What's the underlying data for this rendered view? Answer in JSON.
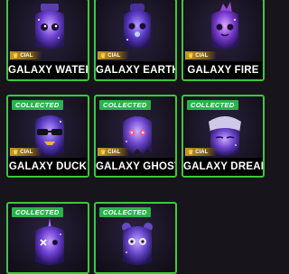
{
  "colors": {
    "card_border": "#3cc83c",
    "badge_bg": "#29b34a",
    "special_bg": "#c89a2c",
    "label_bg": "#000000"
  },
  "cards": [
    {
      "name": "GALAXY WATEF",
      "collected": "",
      "special": "CIAL",
      "icon": "galaxy-water-mascot"
    },
    {
      "name": "GALAXY EARTH",
      "collected": "",
      "special": "CIAL",
      "icon": "galaxy-earth-mascot"
    },
    {
      "name": "GALAXY FIRE",
      "collected": "",
      "special": "CIAL",
      "icon": "galaxy-fire-mascot"
    },
    {
      "name": "GALAXY DUCK",
      "collected": "COLLECTED",
      "special": "CIAL",
      "icon": "galaxy-duck-mascot"
    },
    {
      "name": "GALAXY GHOST",
      "collected": "COLLECTED",
      "special": "CIAL",
      "icon": "galaxy-ghost-mascot"
    },
    {
      "name": "GALAXY DREAM",
      "collected": "COLLECTED",
      "special": "CIAL",
      "icon": "galaxy-dream-mascot"
    },
    {
      "name": "",
      "collected": "COLLECTED",
      "special": "",
      "icon": "galaxy-unicorn-mascot"
    },
    {
      "name": "",
      "collected": "COLLECTED",
      "special": "",
      "icon": "galaxy-teddy-mascot"
    }
  ]
}
